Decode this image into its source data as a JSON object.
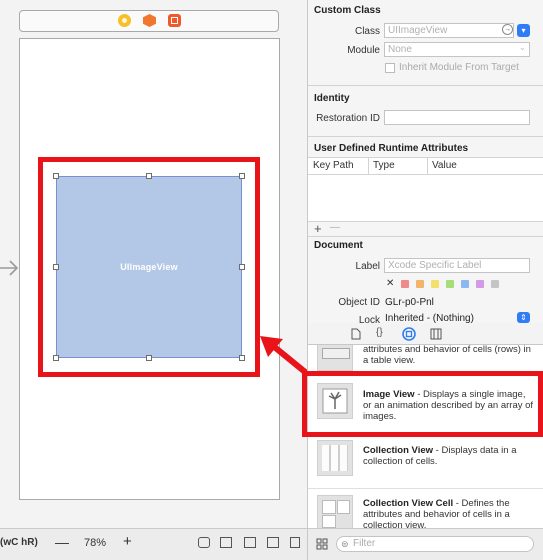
{
  "canvas": {
    "image_view_label": "UIImageView"
  },
  "bottom_bar": {
    "size_class": "(wC hR)",
    "zoom_minus": "—",
    "zoom_level": "78%",
    "zoom_plus": "+"
  },
  "inspector": {
    "custom_class": {
      "title": "Custom Class",
      "class_label": "Class",
      "class_value": "UIImageView",
      "module_label": "Module",
      "module_value": "None",
      "inherit_label": "Inherit Module From Target"
    },
    "identity": {
      "title": "Identity",
      "restoration_label": "Restoration ID",
      "restoration_value": ""
    },
    "runtime_attributes": {
      "title": "User Defined Runtime Attributes",
      "columns": [
        "Key Path",
        "Type",
        "Value"
      ],
      "add": "+",
      "remove": "—"
    },
    "document": {
      "title": "Document",
      "label_label": "Label",
      "label_placeholder": "Xcode Specific Label",
      "clear_mark": "✕",
      "object_id_label": "Object ID",
      "object_id_value": "GLr-p0-Pnl",
      "lock_label": "Lock",
      "lock_value": "Inherited - (Nothing)",
      "swatch_colors": [
        "#f08a8a",
        "#f4b36a",
        "#f2e06a",
        "#a6dd7a",
        "#8ab8f0",
        "#d29ae8",
        "#c4c4c4"
      ]
    }
  },
  "library": {
    "items": [
      {
        "desc": "attributes and behavior of cells (rows) in a table view."
      },
      {
        "name": "Image View",
        "desc": " - Displays a single image, or an animation described by an array of images."
      },
      {
        "name": "Collection View",
        "desc": " - Displays data in a collection of cells."
      },
      {
        "name": "Collection View Cell",
        "desc": " - Defines the attributes and behavior of cells in a collection view."
      }
    ],
    "filter_placeholder": "Filter"
  },
  "colors": {
    "highlight": "#e8141a",
    "image_view_fill": "#b3c8e6",
    "accent_blue": "#2f7cf6"
  }
}
